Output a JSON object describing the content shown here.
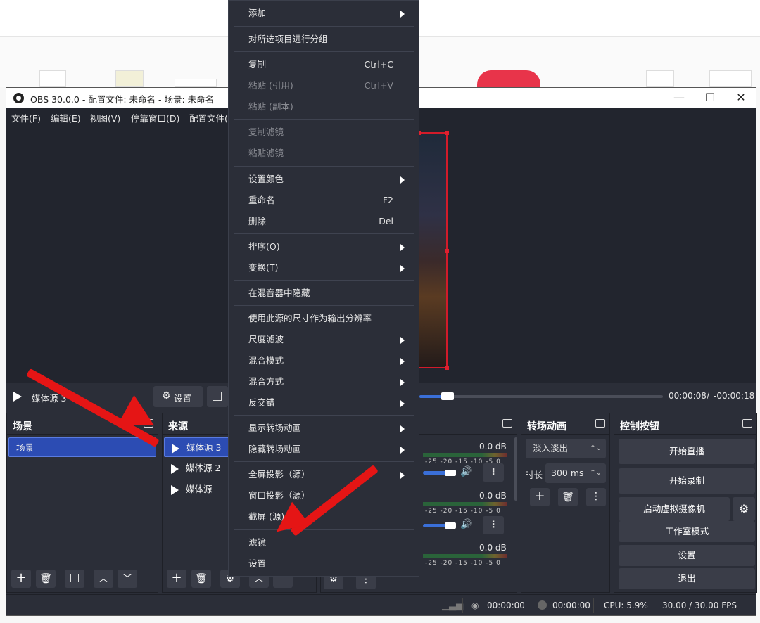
{
  "window": {
    "title": "OBS 30.0.0 - 配置文件: 未命名 - 场景: 未命名",
    "minimize": "—",
    "maximize": "☐",
    "close": "✕"
  },
  "menubar": [
    "文件(F)",
    "编辑(E)",
    "视图(V)",
    "停靠窗口(D)",
    "配置文件("
  ],
  "media": {
    "name": "媒体源 3",
    "settings": "设置",
    "time": "00:00:08",
    "sep": "/",
    "remain": "-00:00:18",
    "progress": 0.1
  },
  "scenes": {
    "title": "场景",
    "items": [
      "场景"
    ]
  },
  "sources": {
    "title": "来源",
    "items": [
      "媒体源 3",
      "媒体源 2",
      "媒体源"
    ]
  },
  "mixer": {
    "levels": [
      "0.0 dB",
      "0.0 dB",
      "0.0 dB"
    ],
    "ticks": "-25 -20 -15 -10 -5 0"
  },
  "transitions": {
    "title": "转场动画",
    "type": "淡入淡出",
    "duration_label": "时长",
    "duration": "300 ms"
  },
  "controls": {
    "title": "控制按钮",
    "buttons": [
      "开始直播",
      "开始录制",
      "启动虚拟摄像机",
      "工作室模式",
      "设置",
      "退出"
    ]
  },
  "status": {
    "rec_time": "00:00:00",
    "stream_time": "00:00:00",
    "cpu": "CPU: 5.9%",
    "fps": "30.00 / 30.00 FPS"
  },
  "context_menu": {
    "items": [
      {
        "label": "添加",
        "shortcut": "",
        "submenu": true,
        "disabled": false
      },
      {
        "label": "对所选项目进行分组",
        "shortcut": "",
        "submenu": false,
        "disabled": false
      },
      {
        "label": "复制",
        "shortcut": "Ctrl+C",
        "submenu": false,
        "disabled": false
      },
      {
        "label": "粘贴 (引用)",
        "shortcut": "Ctrl+V",
        "submenu": false,
        "disabled": true
      },
      {
        "label": "粘贴 (副本)",
        "shortcut": "",
        "submenu": false,
        "disabled": true
      },
      {
        "label": "复制滤镜",
        "shortcut": "",
        "submenu": false,
        "disabled": true
      },
      {
        "label": "粘贴滤镜",
        "shortcut": "",
        "submenu": false,
        "disabled": true
      },
      {
        "label": "设置颜色",
        "shortcut": "",
        "submenu": true,
        "disabled": false
      },
      {
        "label": "重命名",
        "shortcut": "F2",
        "submenu": false,
        "disabled": false
      },
      {
        "label": "删除",
        "shortcut": "Del",
        "submenu": false,
        "disabled": false
      },
      {
        "label": "排序(O)",
        "shortcut": "",
        "submenu": true,
        "disabled": false
      },
      {
        "label": "变换(T)",
        "shortcut": "",
        "submenu": true,
        "disabled": false
      },
      {
        "label": "在混音器中隐藏",
        "shortcut": "",
        "submenu": false,
        "disabled": false
      },
      {
        "label": "使用此源的尺寸作为输出分辨率",
        "shortcut": "",
        "submenu": false,
        "disabled": false
      },
      {
        "label": "尺度滤波",
        "shortcut": "",
        "submenu": true,
        "disabled": false
      },
      {
        "label": "混合模式",
        "shortcut": "",
        "submenu": true,
        "disabled": false
      },
      {
        "label": "混合方式",
        "shortcut": "",
        "submenu": true,
        "disabled": false
      },
      {
        "label": "反交错",
        "shortcut": "",
        "submenu": true,
        "disabled": false
      },
      {
        "label": "显示转场动画",
        "shortcut": "",
        "submenu": true,
        "disabled": false
      },
      {
        "label": "隐藏转场动画",
        "shortcut": "",
        "submenu": true,
        "disabled": false
      },
      {
        "label": "全屏投影（源）",
        "shortcut": "",
        "submenu": true,
        "disabled": false
      },
      {
        "label": "窗口投影（源）",
        "shortcut": "",
        "submenu": false,
        "disabled": false
      },
      {
        "label": "截屏 (源)",
        "shortcut": "",
        "submenu": false,
        "disabled": false
      },
      {
        "label": "滤镜",
        "shortcut": "",
        "submenu": false,
        "disabled": false
      },
      {
        "label": "设置",
        "shortcut": "",
        "submenu": false,
        "disabled": false
      }
    ]
  },
  "colors": {
    "accent": "#2c4cb3",
    "annotation": "#e51515",
    "menu_bg": "#2b2e38"
  }
}
